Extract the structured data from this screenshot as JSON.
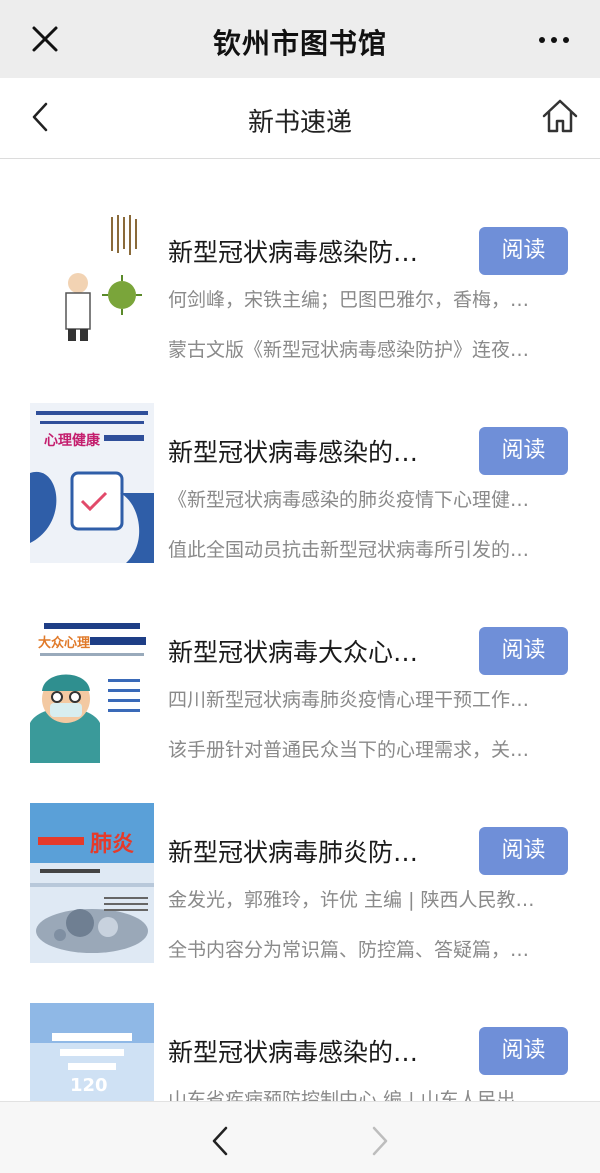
{
  "app": {
    "window_title": "钦州市图书馆",
    "page_title": "新书速递"
  },
  "colors": {
    "read_button": "#6f8fd8",
    "topbar_bg": "#ededed",
    "muted_text": "#8a8a8a"
  },
  "icons": {
    "close": "close-icon",
    "more": "more-icon",
    "back": "chevron-left-icon",
    "home": "home-icon",
    "prev": "chevron-left-icon",
    "next": "chevron-right-icon"
  },
  "books": [
    {
      "title": "新型冠状病毒感染防…",
      "read_label": "阅读",
      "author": "何剑峰，宋铁主编；巴图巴雅尔，香梅，…",
      "description": "蒙古文版《新型冠状病毒感染防护》连夜…",
      "cover_text": ""
    },
    {
      "title": "新型冠状病毒感染的…",
      "read_label": "阅读",
      "author": "《新型冠状病毒感染的肺炎疫情下心理健…",
      "description": "值此全国动员抗击新型冠状病毒所引发的…",
      "cover_text": "心理健康"
    },
    {
      "title": "新型冠状病毒大众心…",
      "read_label": "阅读",
      "author": "四川新型冠状病毒肺炎疫情心理干预工作…",
      "description": "该手册针对普通民众当下的心理需求，关…",
      "cover_text": "大众心理"
    },
    {
      "title": "新型冠状病毒肺炎防…",
      "read_label": "阅读",
      "author": "金发光，郭雅玲，许优 主编 | 陕西人民教…",
      "description": "全书内容分为常识篇、防控篇、答疑篇，…",
      "cover_text": "肺炎"
    },
    {
      "title": "新型冠状病毒感染的…",
      "read_label": "阅读",
      "author": "山东省疾病预防控制中心 编 | 山东人民出…",
      "description": "",
      "cover_text": "120"
    }
  ]
}
